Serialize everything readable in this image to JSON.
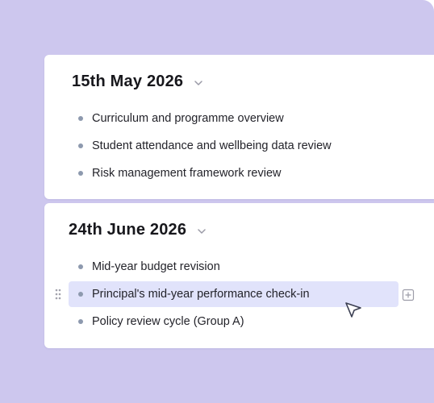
{
  "sections": [
    {
      "date": "15th May 2026",
      "items": [
        {
          "label": "Curriculum and programme overview"
        },
        {
          "label": "Student attendance and wellbeing data review"
        },
        {
          "label": "Risk management framework review"
        }
      ]
    },
    {
      "date": "24th June 2026",
      "items": [
        {
          "label": "Mid-year budget revision"
        },
        {
          "label": "Principal's mid-year performance check-in"
        },
        {
          "label": "Policy review cycle (Group A)"
        }
      ]
    }
  ],
  "icons": {
    "chevron": "chevron-down-icon",
    "drag": "drag-handle-icon",
    "add": "plus-square-icon",
    "cursor": "mouse-pointer-icon"
  },
  "colors": {
    "background": "#cdc7ee",
    "card": "#ffffff",
    "highlight": "#e1e3fb",
    "bullet": "#8d99ae",
    "text": "#23232a"
  }
}
